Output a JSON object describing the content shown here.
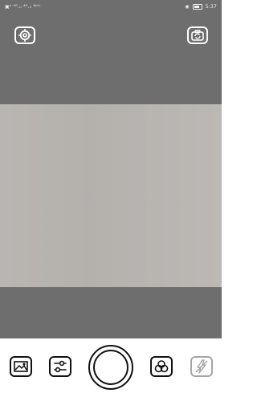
{
  "status_bar": {
    "left_indicators": "▣ᵃ ⁴ᴳ.ᵢₗ ⁴ᴳ.ᵢₗ ᵂᶦᶠᶦ",
    "right_indicators": "◉",
    "time": "5:37"
  },
  "top_controls": {
    "settings_icon": "gear-icon",
    "switch_camera_icon": "camera-switch-icon"
  },
  "bottom_toolbar": {
    "gallery_icon": "image-icon",
    "adjust_icon": "sliders-icon",
    "shutter_icon": "shutter-icon",
    "filters_icon": "filters-icon",
    "flash_icon": "flash-off-icon"
  },
  "colors": {
    "viewfinder": "#6e6e6e",
    "preview_surface": "#b9b6b2",
    "toolbar": "#ffffff"
  }
}
